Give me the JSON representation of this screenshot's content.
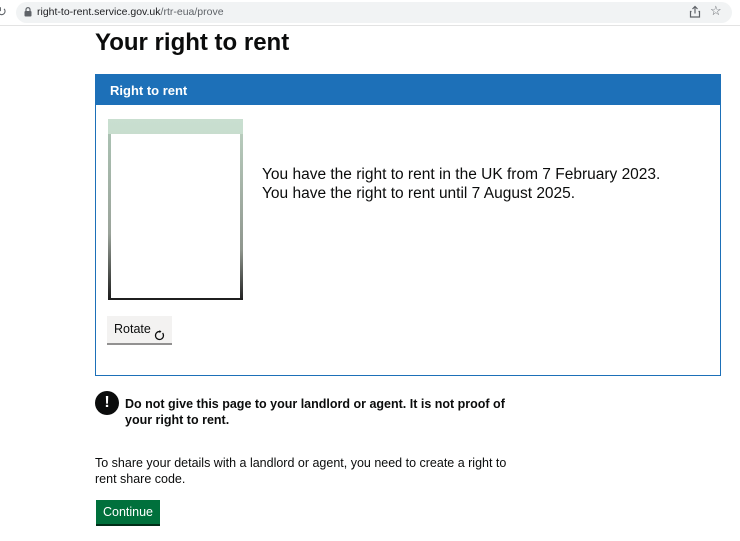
{
  "browser": {
    "url_host": "right-to-rent.service.gov.uk",
    "url_path": "/rtr-eua/prove",
    "icons": [
      "reload-icon",
      "lock-icon",
      "share-icon",
      "star-icon"
    ]
  },
  "page": {
    "title": "Your right to rent"
  },
  "panel": {
    "title": "Right to rent",
    "lines": [
      "You have the right to rent in the UK from 7 February 2023.",
      "You have the right to rent until 7 August 2025."
    ],
    "rotate_label": "Rotate",
    "rotate_icon": "rotate-icon"
  },
  "warning": {
    "icon_symbol": "!",
    "text": "Do not give this page to your landlord or agent. It is not proof of your right to rent."
  },
  "share": {
    "text": "To share your details with a landlord or agent, you need to create a right to rent share code."
  },
  "actions": {
    "continue_label": "Continue"
  },
  "colors": {
    "panel_blue": "#1d70b8",
    "button_green": "#00703c",
    "text": "#0b0c0c"
  }
}
